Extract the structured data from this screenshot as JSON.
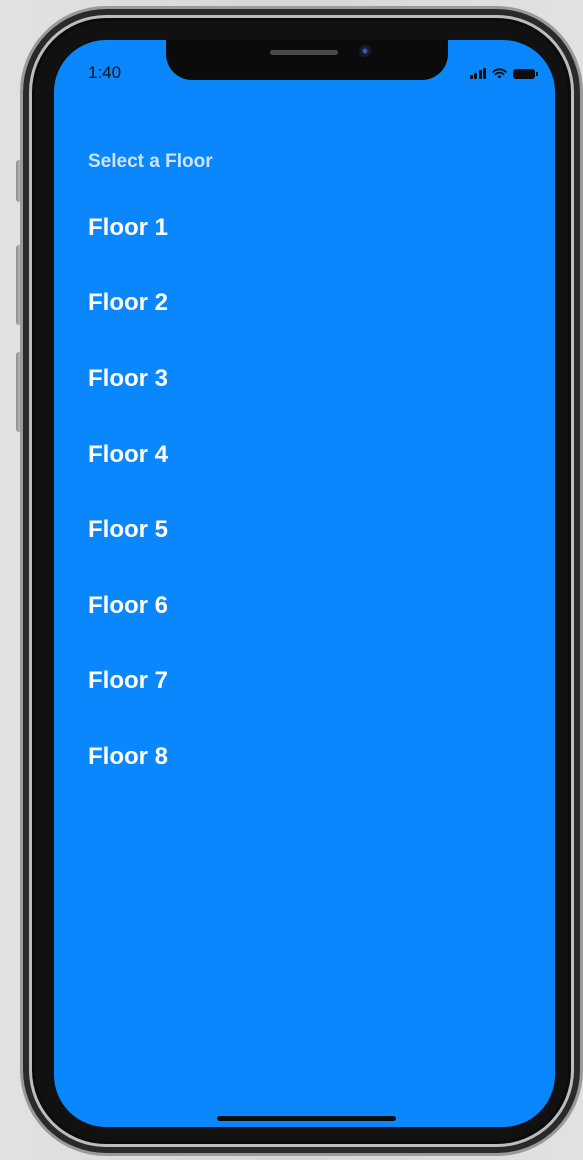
{
  "status_bar": {
    "time": "1:40",
    "icons": [
      "signal-icon",
      "wifi-icon",
      "battery-icon"
    ]
  },
  "screen": {
    "background_color": "#0a87fd",
    "heading": "Select a Floor",
    "floors": [
      {
        "label": "Floor 1"
      },
      {
        "label": "Floor 2"
      },
      {
        "label": "Floor 3"
      },
      {
        "label": "Floor 4"
      },
      {
        "label": "Floor 5"
      },
      {
        "label": "Floor 6"
      },
      {
        "label": "Floor 7"
      },
      {
        "label": "Floor 8"
      }
    ]
  }
}
